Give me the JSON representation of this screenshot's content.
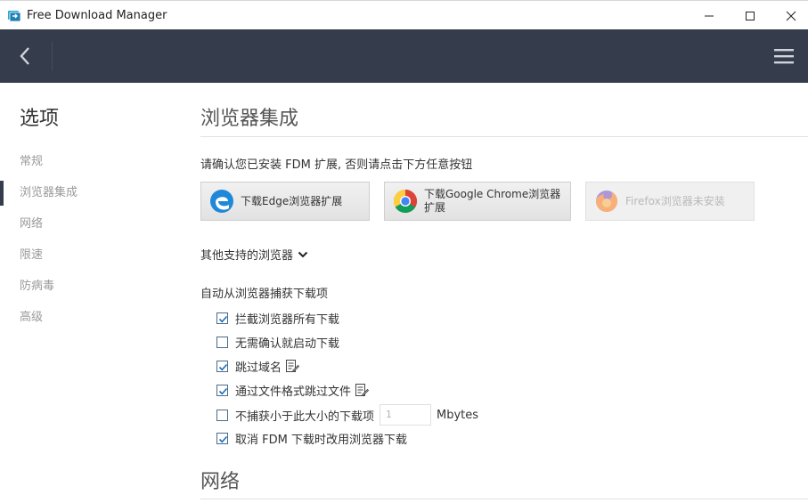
{
  "window": {
    "title": "Free Download Manager"
  },
  "sidebar": {
    "title": "选项",
    "items": [
      {
        "label": "常规"
      },
      {
        "label": "浏览器集成"
      },
      {
        "label": "网络"
      },
      {
        "label": "限速"
      },
      {
        "label": "防病毒"
      },
      {
        "label": "高级"
      }
    ],
    "active_index": 1
  },
  "main": {
    "section_title": "浏览器集成",
    "confirm_text": "请确认您已安装 FDM 扩展, 否则请点击下方任意按钮",
    "buttons": [
      {
        "label": "下载Edge浏览器扩展",
        "icon": "edge-icon"
      },
      {
        "label": "下载Google Chrome浏览器扩展",
        "icon": "chrome-icon"
      },
      {
        "label": "Firefox浏览器未安装",
        "icon": "firefox-icon",
        "disabled": true
      }
    ],
    "other_browsers": "其他支持的浏览器",
    "capture_title": "自动从浏览器捕获下载项",
    "options": [
      {
        "label": "拦截浏览器所有下载",
        "checked": true
      },
      {
        "label": "无需确认就启动下载",
        "checked": false
      },
      {
        "label": "跳过域名",
        "checked": true
      },
      {
        "label": "通过文件格式跳过文件",
        "checked": true
      },
      {
        "label": "不捕获小于此大小的下载项",
        "checked": false
      },
      {
        "label": "取消 FDM 下载时改用浏览器下载",
        "checked": true
      }
    ],
    "size_value": "1",
    "size_unit": "Mbytes",
    "next_section_title": "网络"
  },
  "colors": {
    "header_bg": "#353c4b",
    "accent": "#4c6b8a",
    "sidebar_text": "#9a9a9a"
  }
}
